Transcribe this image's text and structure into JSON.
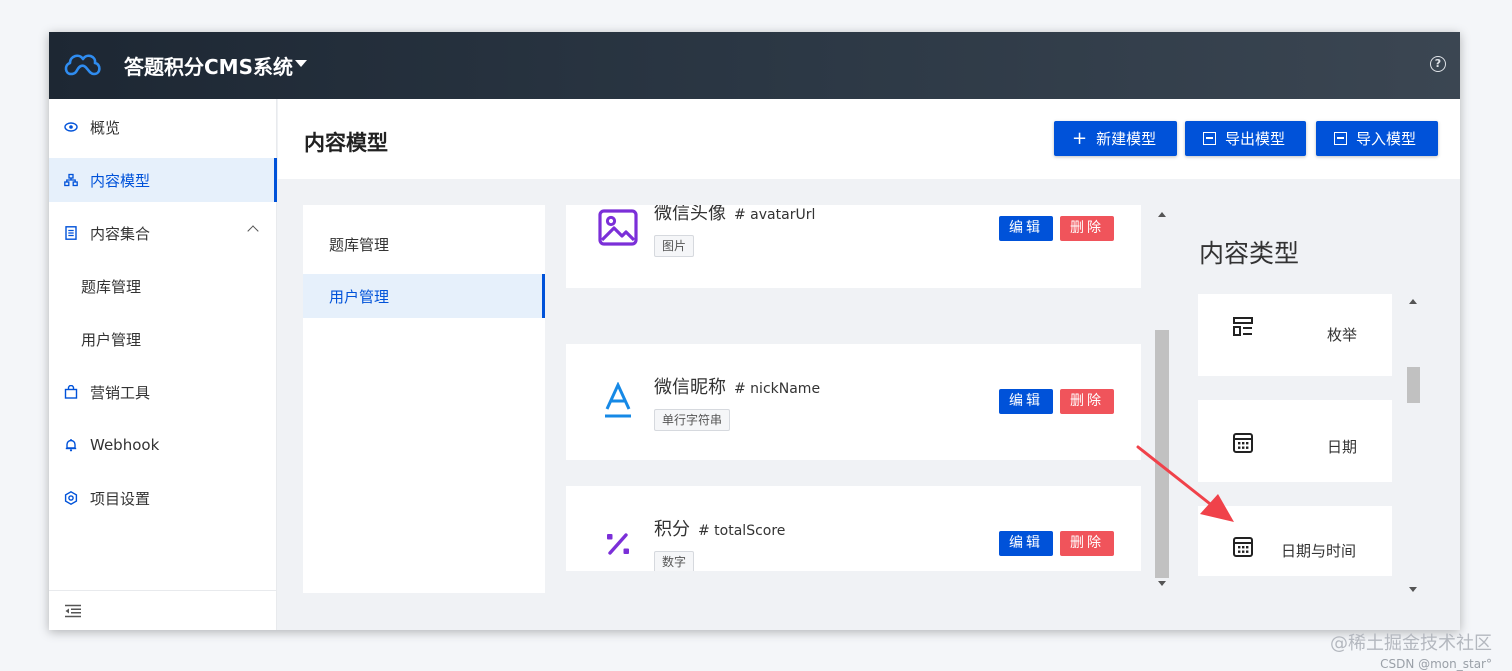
{
  "app": {
    "title": "答题积分CMS系统"
  },
  "sidebar": {
    "items": [
      {
        "label": "概览",
        "icon": "eye-icon"
      },
      {
        "label": "内容模型",
        "icon": "sitemap-icon",
        "active": true
      },
      {
        "label": "内容集合",
        "icon": "document-icon",
        "expanded": true
      },
      {
        "label": "题库管理",
        "sub": true
      },
      {
        "label": "用户管理",
        "sub": true
      },
      {
        "label": "营销工具",
        "icon": "shopping-bag-icon"
      },
      {
        "label": "Webhook",
        "icon": "bell-icon"
      },
      {
        "label": "项目设置",
        "icon": "settings-icon"
      }
    ]
  },
  "header": {
    "title": "内容模型",
    "buttons": [
      {
        "label": "新建模型",
        "icon": "plus-icon"
      },
      {
        "label": "导出模型",
        "icon": "export-icon"
      },
      {
        "label": "导入模型",
        "icon": "import-icon"
      }
    ]
  },
  "collections": {
    "items": [
      {
        "label": "题库管理",
        "active": false
      },
      {
        "label": "用户管理",
        "active": true
      }
    ]
  },
  "fields": {
    "edit_label": "编辑",
    "delete_label": "删除",
    "items": [
      {
        "name": "微信头像",
        "key": "# avatarUrl",
        "type": "图片",
        "icon": "image-icon"
      },
      {
        "name": "微信昵称",
        "key": "# nickName",
        "type": "单行字符串",
        "icon": "text-icon"
      },
      {
        "name": "积分",
        "key": "# totalScore",
        "type": "数字",
        "icon": "percent-icon"
      }
    ]
  },
  "types": {
    "title": "内容类型",
    "items": [
      {
        "label": "枚举",
        "icon": "enum-icon"
      },
      {
        "label": "日期",
        "icon": "calendar-icon"
      },
      {
        "label": "日期与时间",
        "icon": "calendar-time-icon"
      }
    ]
  },
  "watermark": {
    "line1": "@稀土掘金技术社区",
    "line2": "CSDN @mon_star°"
  },
  "colors": {
    "primary": "#0052d9",
    "danger": "#f0545b",
    "topbar": "#2b3744",
    "annotation_arrow": "#f0424a"
  }
}
